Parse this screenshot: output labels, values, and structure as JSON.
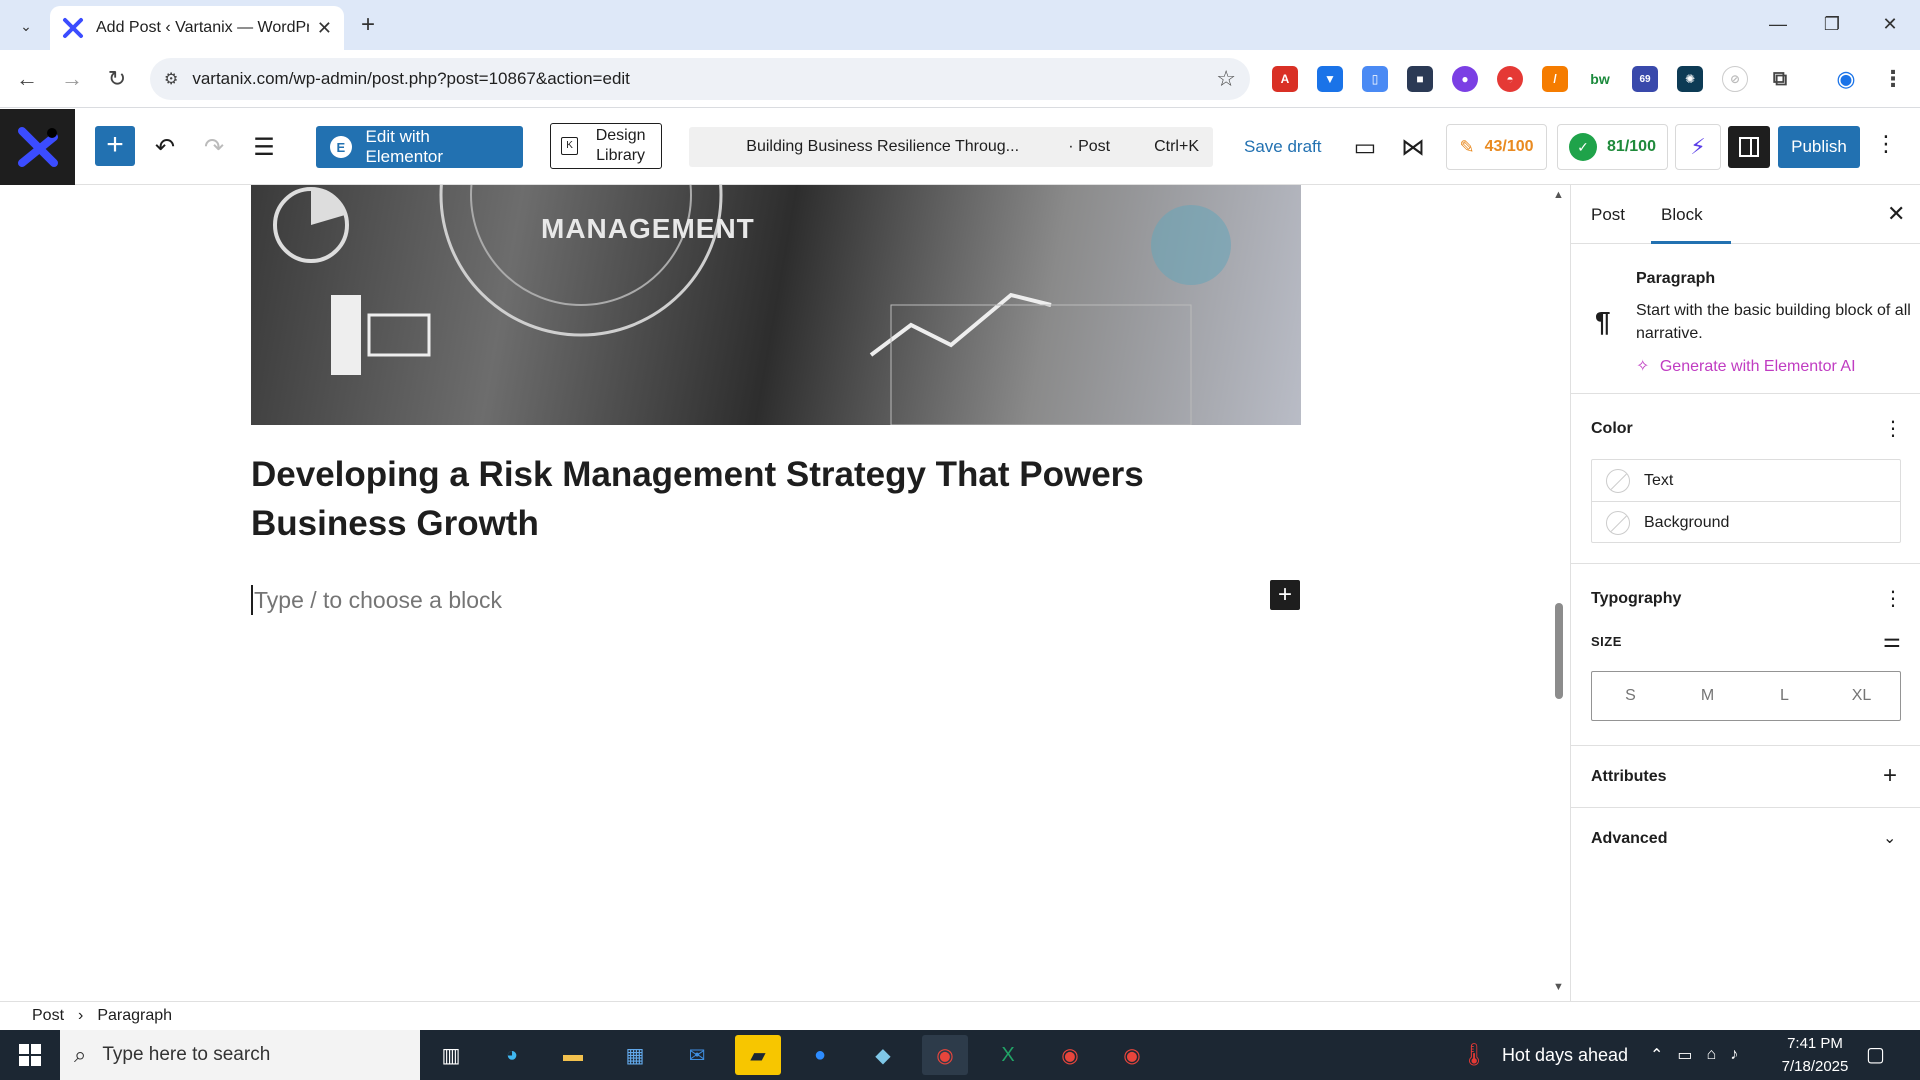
{
  "browser": {
    "tab_title": "Add Post ‹ Vartanix — WordPre",
    "url": "vartanix.com/wp-admin/post.php?post=10867&action=edit",
    "extension_badge": "69"
  },
  "toolbar": {
    "edit_with_elementor": "Edit with Elementor",
    "design_library": "Design Library",
    "command_title": "Building Business Resilience Throug...",
    "command_type": "· Post",
    "command_shortcut": "Ctrl+K",
    "save_draft": "Save draft",
    "score_1": "43/100",
    "score_2": "81/100",
    "publish": "Publish"
  },
  "canvas": {
    "image_text": "MANAGEMENT",
    "post_title": "Developing a Risk Management Strategy That Powers Business Growth",
    "paragraph_placeholder": "Type / to choose a block"
  },
  "sidebar": {
    "tabs": [
      "Post",
      "Block"
    ],
    "active_tab": "Block",
    "block_name": "Paragraph",
    "block_description": "Start with the basic building block of all narrative.",
    "generate_ai": "Generate with Elementor AI",
    "color": {
      "title": "Color",
      "rows": [
        "Text",
        "Background"
      ]
    },
    "typography": {
      "title": "Typography",
      "size_label": "SIZE",
      "sizes": [
        "S",
        "M",
        "L",
        "XL"
      ]
    },
    "attributes": "Attributes",
    "advanced": "Advanced"
  },
  "footer": {
    "crumbs": [
      "Post",
      "Paragraph"
    ]
  },
  "taskbar": {
    "search_placeholder": "Type here to search",
    "weather": "Hot days ahead",
    "time": "7:41 PM",
    "date": "7/18/2025"
  },
  "colors": {
    "wp_blue": "#2271b1",
    "elementor_ai": "#c03cc2",
    "taskbar": "#1c2733",
    "tabbar": "#dee8f8"
  }
}
